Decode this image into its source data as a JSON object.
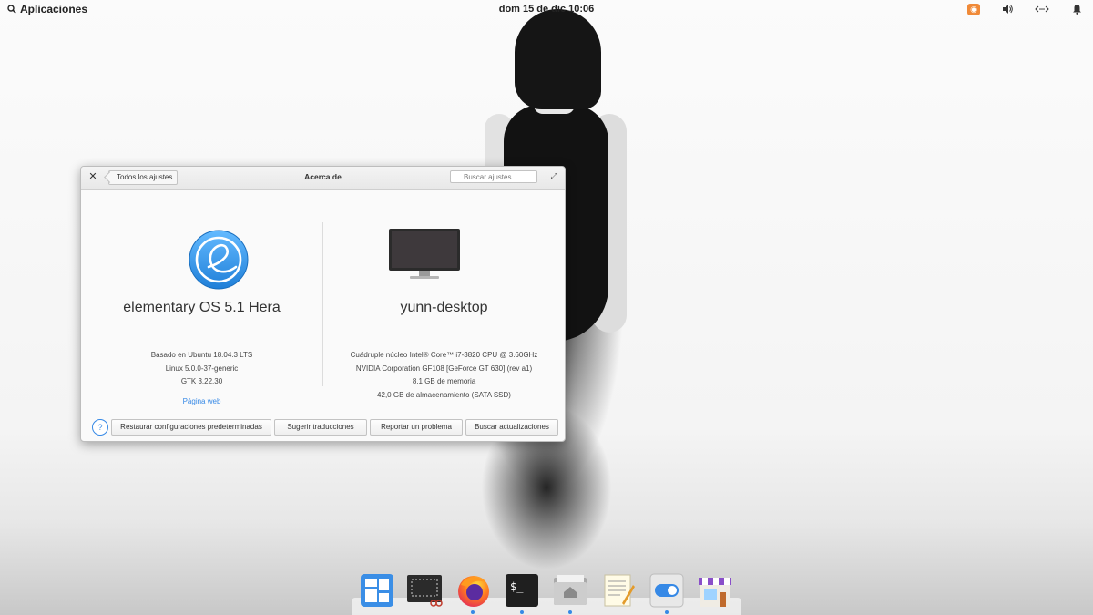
{
  "panel": {
    "apps_label": "Aplicaciones",
    "clock": "dom 15 de dic 10:06",
    "indicators": [
      "orange-app-icon",
      "volume-icon",
      "network-icon",
      "notifications-icon"
    ]
  },
  "window": {
    "title": "Acerca de",
    "back_label": "Todos los ajustes",
    "search_placeholder": "Buscar ajustes",
    "os": {
      "name": "elementary OS 5.1 Hera",
      "based_on": "Basado en Ubuntu 18.04.3 LTS",
      "kernel": "Linux 5.0.0-37-generic",
      "gtk": "GTK 3.22.30",
      "website_link": "Página web"
    },
    "hardware": {
      "hostname": "yunn-desktop",
      "cpu": "Cuádruple núcleo Intel® Core™ i7-3820 CPU @ 3.60GHz",
      "gpu": "NVIDIA Corporation GF108 [GeForce GT 630] (rev a1)",
      "memory": "8,1 GB de memoria",
      "storage": "42,0 GB de almacenamiento (SATA SSD)"
    },
    "footer": {
      "help": "?",
      "restore": "Restaurar configuraciones predeterminadas",
      "translations": "Sugerir traducciones",
      "report": "Reportar un problema",
      "updates": "Buscar actualizaciones"
    }
  },
  "dock": {
    "apps": [
      "Multitarea",
      "Captura de pantalla",
      "Firefox",
      "Terminal",
      "Archivos",
      "Editor de texto",
      "Configuración del sistema",
      "AppCenter"
    ],
    "terminal_glyph": "$_"
  },
  "colors": {
    "accent": "#3689e6",
    "panel_indicator": "#f08a38"
  }
}
